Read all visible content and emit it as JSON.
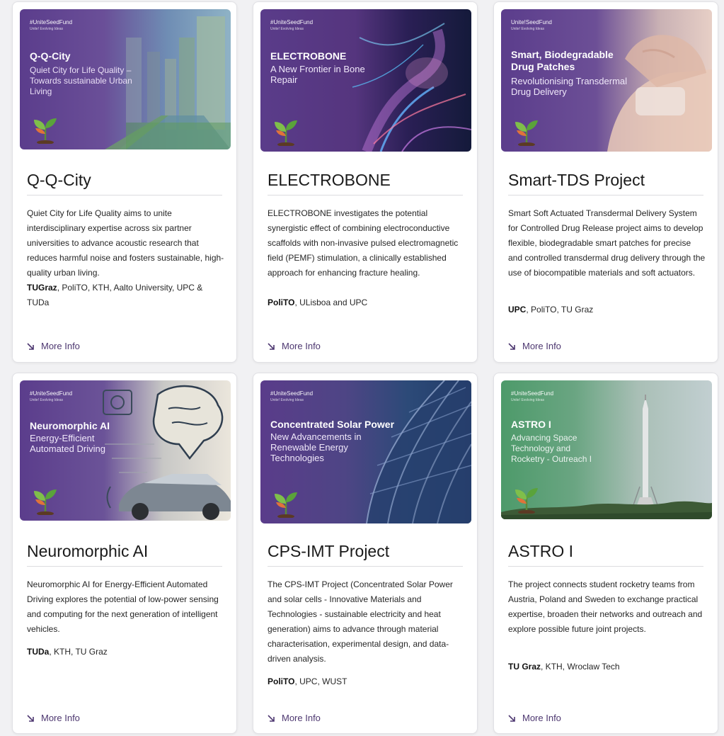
{
  "more_label": "More Info",
  "cards": [
    {
      "thumb": {
        "tag": "#UniteSeedFund",
        "tag_sub": "Unite! Evolving Ideas",
        "title": "Q-Q-City",
        "subtitle": "Quiet City for Life Quality – Towards sustainable Urban Living"
      },
      "title": "Q-Q-City",
      "description": "Quiet City for Life Quality aims to unite interdisciplinary expertise across six partner universities to advance acoustic research that reduces harmful noise and fosters sustainable, high-quality urban living.",
      "lead_partner": "TUGraz",
      "other_partners": ", PoliTO, KTH, Aalto University, UPC & TUDa"
    },
    {
      "thumb": {
        "tag": "#UniteSeedFund",
        "tag_sub": "Unite! Evolving Ideas",
        "title": "ELECTROBONE",
        "subtitle": "A New Frontier in Bone Repair"
      },
      "title": "ELECTROBONE",
      "description": "ELECTROBONE investigates the potential synergistic effect of combining electroconductive scaffolds with non-invasive pulsed electromagnetic field (PEMF) stimulation, a clinically established approach for enhancing fracture healing.",
      "lead_partner": "PoliTO",
      "other_partners": ", ULisboa and UPC"
    },
    {
      "thumb": {
        "tag": "Unite!SeedFund",
        "tag_sub": "Unite! Evolving Ideas",
        "title": "Smart, Biodegradable Drug Patches",
        "subtitle": "Revolutionising Transdermal Drug Delivery"
      },
      "title": "Smart-TDS Project",
      "description": "Smart Soft Actuated Transdermal Delivery System for Controlled Drug Release project aims to develop flexible, biodegradable smart patches for precise and controlled transdermal drug delivery through the use of biocompatible materials and soft actuators.",
      "lead_partner": "UPC",
      "other_partners": ", PoliTO, TU Graz"
    },
    {
      "thumb": {
        "tag": "#UniteSeedFund",
        "tag_sub": "Unite! Evolving Ideas",
        "title": "Neuromorphic AI",
        "subtitle": "Energy-Efficient Automated Driving"
      },
      "title": "Neuromorphic AI",
      "description": "Neuromorphic AI for Energy-Efficient Automated Driving explores the potential of low-power sensing and computing for the next generation of intelligent vehicles.",
      "lead_partner": "TUDa",
      "other_partners": ", KTH, TU Graz"
    },
    {
      "thumb": {
        "tag": "#UniteSeedFund",
        "tag_sub": "Unite! Evolving Ideas",
        "title": "Concentrated Solar Power",
        "subtitle": "New Advancements in Renewable Energy Technologies"
      },
      "title": "CPS-IMT Project",
      "description": "The CPS-IMT Project (Concentrated Solar Power and solar cells - Innovative Materials and Technologies - sustainable electricity and heat generation) aims to advance through material characterisation, experimental design, and data-driven analysis.",
      "lead_partner": "PoliTO",
      "other_partners": ", UPC, WUST"
    },
    {
      "thumb": {
        "tag": "#UniteSeedFund",
        "tag_sub": "Unite! Evolving Ideas",
        "title": "ASTRO I",
        "subtitle": "Advancing Space Technology and Rocketry - Outreach I"
      },
      "title": "ASTRO I",
      "description": "The project connects student rocketry teams from Austria, Poland and Sweden to exchange practical expertise, broaden their networks and outreach and explore possible future joint projects.",
      "lead_partner": "TU Graz",
      "other_partners": ", KTH, Wroclaw Tech"
    }
  ],
  "colors": {
    "brand_purple": "#5a3d8a",
    "link_purple": "#4d3770",
    "astro_green": "#4d9a6a"
  }
}
